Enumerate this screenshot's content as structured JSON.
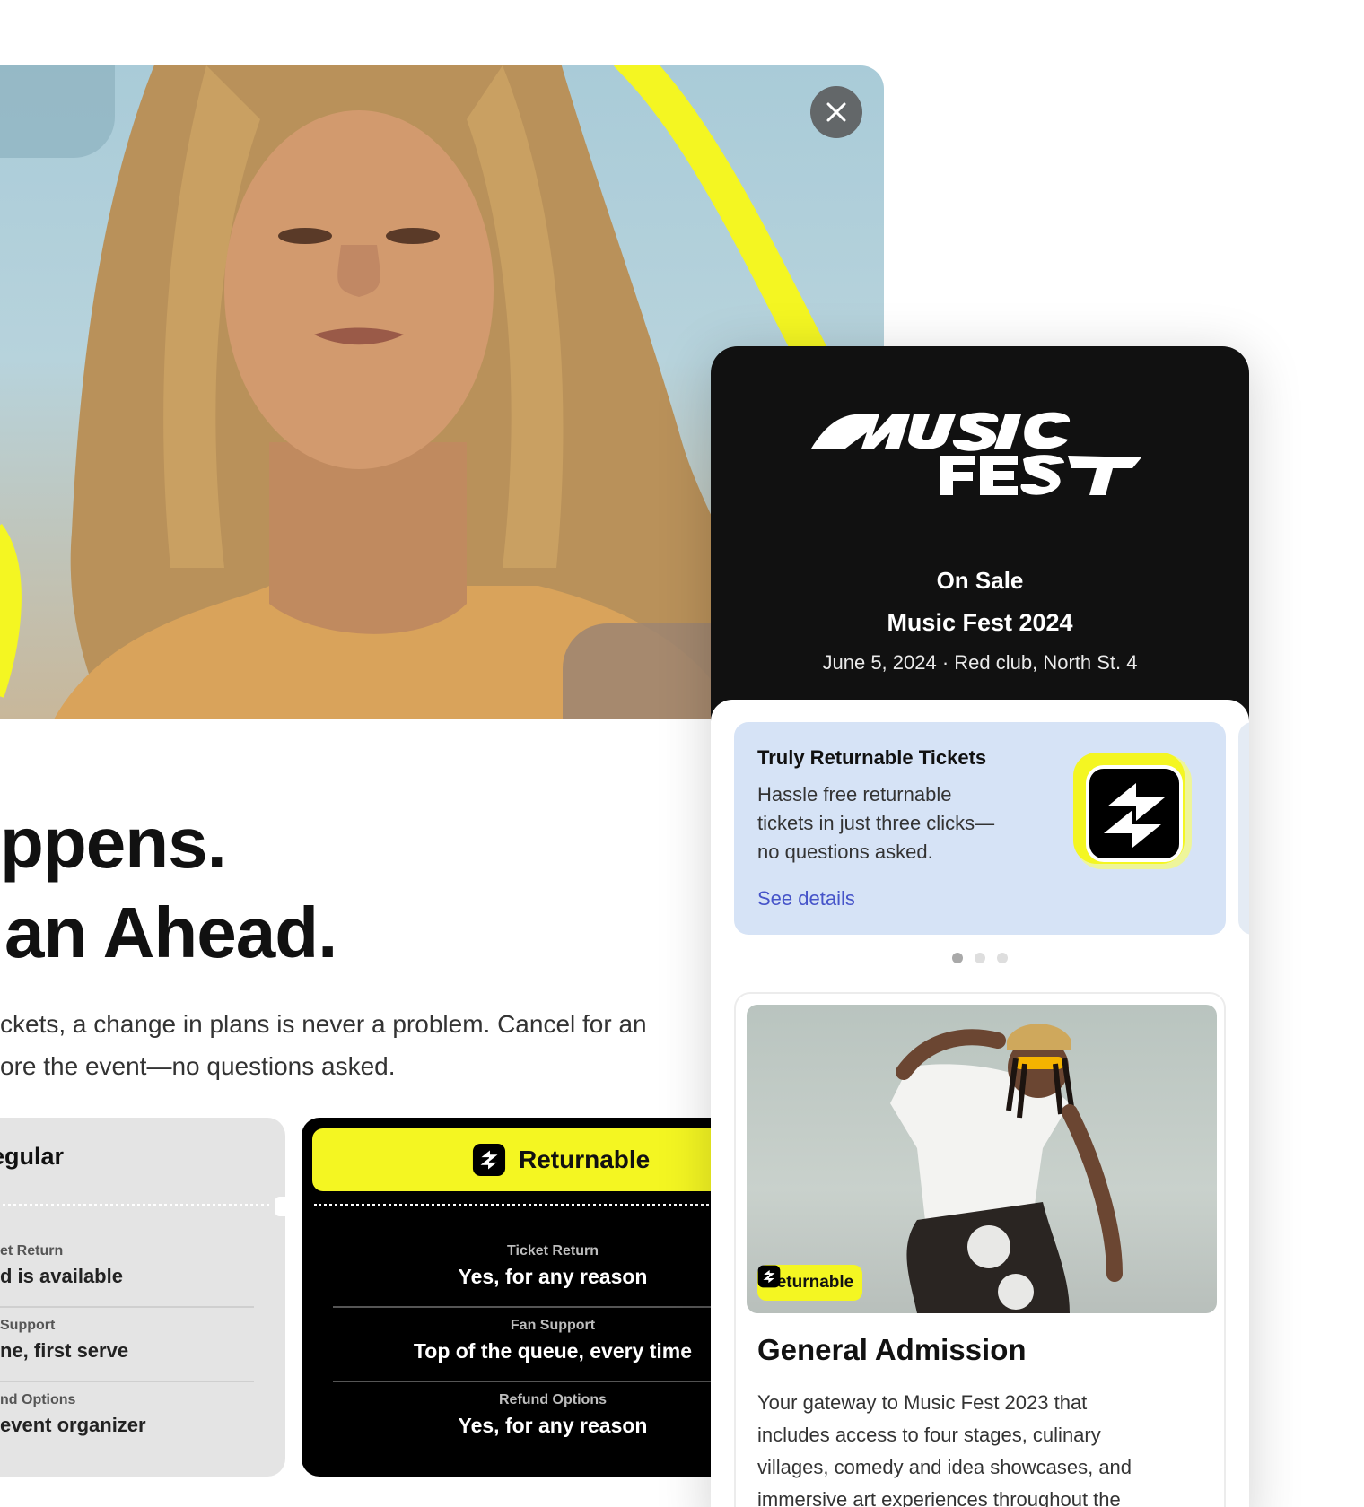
{
  "hero": {
    "close_label": "Close"
  },
  "headline": {
    "line1": "ppens.",
    "line2": "an Ahead."
  },
  "body_copy": {
    "line1": "ckets, a change in plans is never a problem. Cancel for an",
    "line2": "ore the event—no questions asked."
  },
  "comparison": {
    "regular": {
      "title": "egular",
      "rows": [
        {
          "label": "et Return",
          "value": "d is available"
        },
        {
          "label": "Support",
          "value": "ne, first serve"
        },
        {
          "label": "nd Options",
          "value": "event organizer"
        }
      ]
    },
    "returnable": {
      "title": "Returnable",
      "rows": [
        {
          "label": "Ticket Return",
          "value": "Yes, for any reason"
        },
        {
          "label": "Fan Support",
          "value": "Top of the queue, every time"
        },
        {
          "label": "Refund Options",
          "value": "Yes, for any reason"
        }
      ]
    }
  },
  "event": {
    "logo_text": "MUSIC FEST",
    "status": "On Sale",
    "name": "Music Fest 2024",
    "meta": "June 5, 2024 · Red club, North St. 4"
  },
  "promo": {
    "title": "Truly Returnable Tickets",
    "desc_lines": [
      "Hassle free returnable",
      "tickets in just three clicks—",
      "no questions asked."
    ],
    "link": "See details",
    "pager_count": 3,
    "pager_active": 0
  },
  "ticket": {
    "tag": "Returnable",
    "title": "General Admission",
    "desc_lines": [
      "Your gateway to Music Fest 2023 that",
      "includes access to four stages, culinary",
      "villages, comedy and idea showcases, and",
      "immersive art experiences throughout the"
    ]
  },
  "colors": {
    "accent_yellow": "#f4f622",
    "link_blue": "#4654c9",
    "panel_dark": "#111111",
    "promo_bg": "#d6e3f6"
  }
}
